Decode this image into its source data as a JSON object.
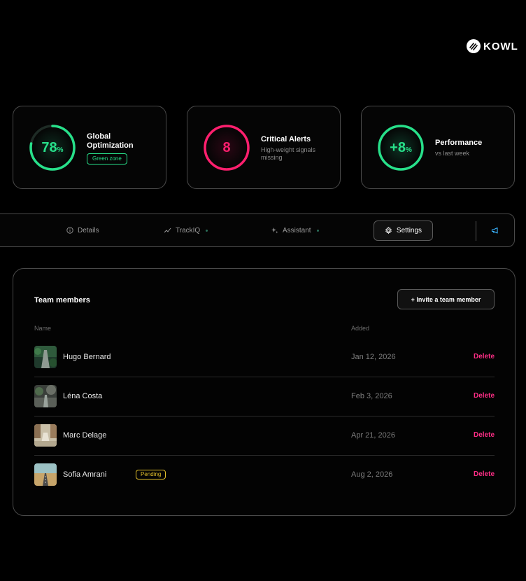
{
  "brand": {
    "name": "KOWL"
  },
  "stats": [
    {
      "value": "78",
      "unit": "%",
      "progress": 0.78,
      "title_line1": "Global",
      "title_line2": "Optimization",
      "badge": "Green zone",
      "color": "#27e08a"
    },
    {
      "value": "8",
      "title": "Critical Alerts",
      "sub_line1": "High-weight signals",
      "sub_line2": "missing",
      "color": "#ff1f6e"
    },
    {
      "value": "+8",
      "unit": "%",
      "title": "Performance",
      "sub": "vs last week",
      "color": "#27e08a"
    }
  ],
  "tabs": {
    "details": "Details",
    "trackiq": "TrackIQ",
    "assistant": "Assistant",
    "settings": "Settings"
  },
  "team": {
    "title": "Team members",
    "invite_label": "+ Invite a team member",
    "col_name": "Name",
    "col_added": "Added",
    "members": [
      {
        "name": "Hugo Bernard",
        "added": "Jan 12, 2026",
        "action": "Delete"
      },
      {
        "name": "Léna Costa",
        "added": "Feb 3, 2026",
        "action": "Delete"
      },
      {
        "name": "Marc Delage",
        "added": "Apr 21, 2026",
        "action": "Delete"
      },
      {
        "name": "Sofia Amrani",
        "status": "Pending",
        "added": "Aug 2, 2026",
        "action": "Delete"
      }
    ]
  },
  "colors": {
    "accent_green": "#27e08a",
    "alert_pink": "#ff1f6e",
    "delete_pink": "#ff2e86",
    "pending_yellow": "#e3c02b"
  }
}
